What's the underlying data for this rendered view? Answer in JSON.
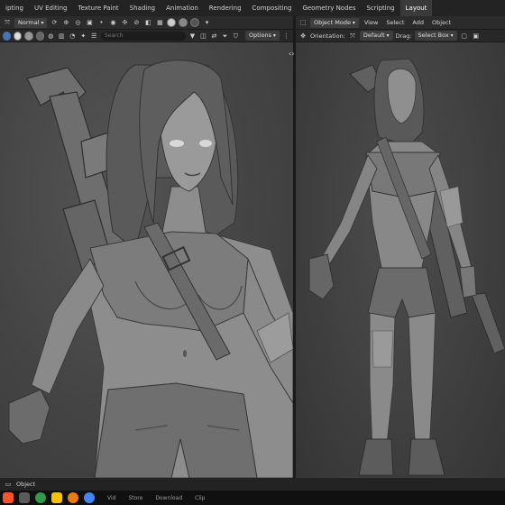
{
  "workspace_tabs": [
    "ipting",
    "UV Editing",
    "Texture Paint",
    "Shading",
    "Animation",
    "Rendering",
    "Compositing",
    "Geometry Nodes",
    "Scripting",
    "Layout"
  ],
  "active_tab_index": 9,
  "left_header": {
    "mode": "Normal",
    "options_label": "Options",
    "search_placeholder": "Search"
  },
  "right_header": {
    "mode": "Object Mode",
    "menu": [
      "View",
      "Select",
      "Add",
      "Object"
    ],
    "orientation_label": "Orientation:",
    "orientation_value": "Default",
    "drag_label": "Drag:",
    "drag_value": "Select Box"
  },
  "status": {
    "label": "Object"
  },
  "taskbar": {
    "items": [
      "Vid",
      "Store",
      "Download",
      "Clip"
    ]
  },
  "colors": {
    "accent": "#4772b3",
    "brave": "#fb542b",
    "chrome": "#4285f4",
    "blender": "#e87d0d"
  }
}
